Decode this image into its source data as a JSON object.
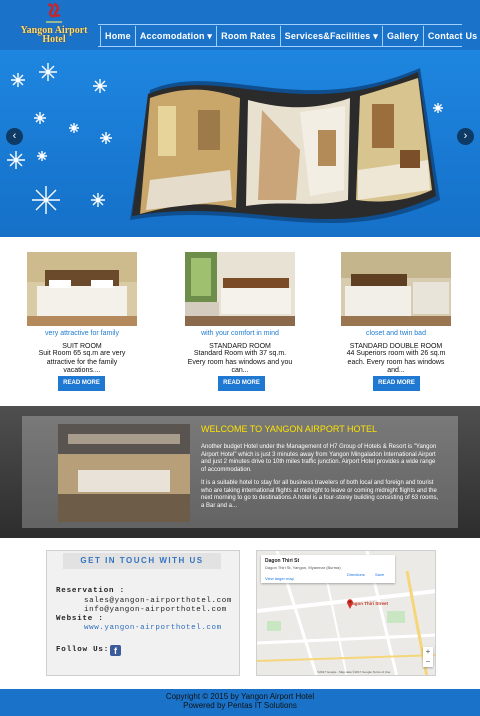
{
  "brand": {
    "name_line1": "Yangon Airport",
    "name_line2": "Hotel"
  },
  "nav": {
    "items": [
      "Home",
      "Accomodation ▾",
      "Room Rates",
      "Services&Facilities ▾",
      "Gallery",
      "Contact Us"
    ]
  },
  "slider": {
    "prev_icon": "chevron-left-icon",
    "next_icon": "chevron-right-icon"
  },
  "rooms": [
    {
      "tagline": "very attractive for family",
      "title": "SUIT ROOM",
      "desc": "Suit Room  65 sq.m are very attractive for the family vacations....",
      "button": "READ MORE"
    },
    {
      "tagline": "with your comfort in mind",
      "title": "STANDARD ROOM",
      "desc": "Standard Room with 37 sq.m. Every room has windows and you can...",
      "button": "READ MORE"
    },
    {
      "tagline": "closet and twin bad",
      "title": "STANDARD DOUBLE ROOM",
      "desc": "44 Superiors room with 26 sq.m each. Every room has windows and...",
      "button": "READ MORE"
    }
  ],
  "welcome": {
    "title": "WELCOME TO YANGON AIRPORT HOTEL",
    "para1": "Another budget Hotel under the Management of H7 Group of Hotels & Resort is \"Yangon Airport Hotel\" which is just 3 minutes away from Yangon Mingaladon International  Airport and just 2 minutes drive to 10th miles traffic junction. Airport Hotel provides a wide range of accommodation.",
    "para2": "It is a suitable hotel to stay for all business travelers of both local and foreign and tourist who are taking international flights at midnight to leave or coming midnight flights and the next morning to go to destinations.A hotel is a four-storey building consisting of 63 rooms, a Bar and a..."
  },
  "contact": {
    "heading": "GET IN TOUCH WITH US",
    "reservation_label": "Reservation :",
    "email1": "sales@yangon-airporthotel.com",
    "email2": "info@yangon-airporthotel.com",
    "website_label": "Website :",
    "website": "www.yangon-airporthotel.com",
    "follow_label": "Follow Us:"
  },
  "map": {
    "place": "Dagon Thiri St",
    "address": "Dagon Thiri St, Yangon, Myanmar (Burma)",
    "view_larger": "View larger map",
    "directions": "Directions",
    "save": "Save",
    "pin_label": "Dagon Thiri Street",
    "footer": "©2017 Google · Map data ©2017 Google   Terms of Use"
  },
  "footer": {
    "line1": "Copyright © 2015 by Yangon Airport Hotel",
    "line2": "Powered by Pentas IT Solutions"
  },
  "colors": {
    "header": "#1a73c9",
    "accent": "#1f78d1",
    "welcome_title": "#ffe400"
  }
}
